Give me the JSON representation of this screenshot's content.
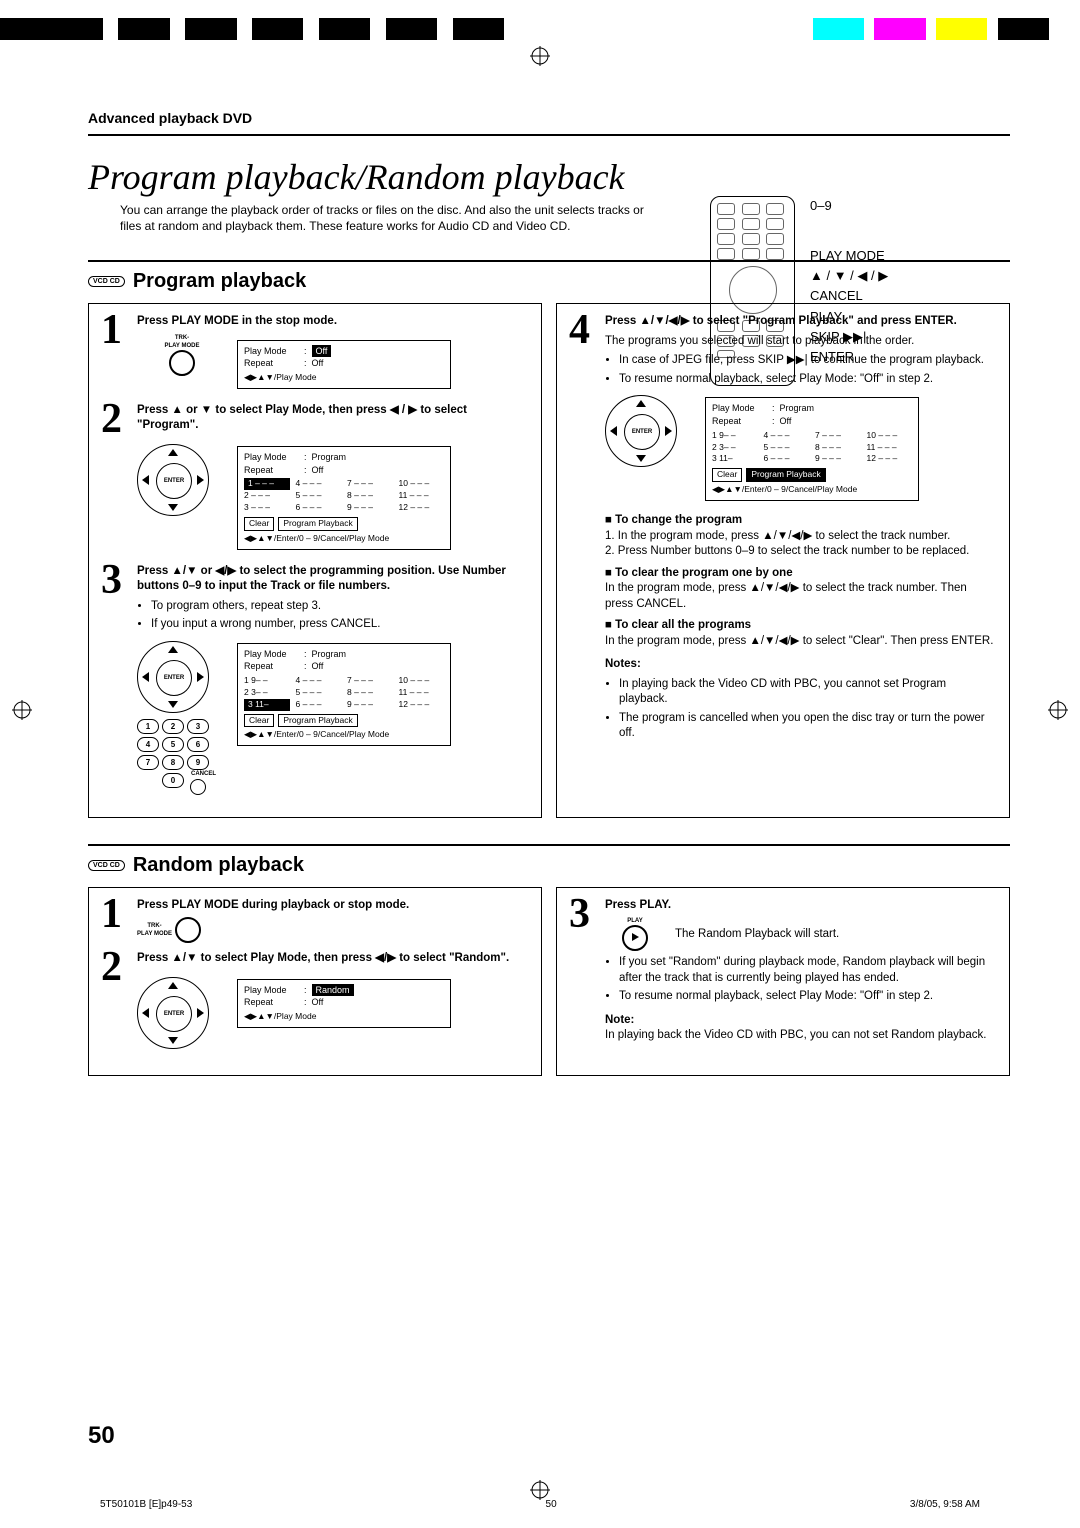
{
  "header": {
    "section": "Advanced playback DVD"
  },
  "title": "Program playback/Random playback",
  "intro": "You can arrange the playback order of tracks or files on the disc. And also the unit selects tracks or files at random and playback them. These feature works for Audio CD and Video CD.",
  "remote_labels": {
    "l0": "0–9",
    "l1": "PLAY MODE",
    "l2": "▲ / ▼ / ◀ / ▶",
    "l3": "CANCEL",
    "l4": "PLAY",
    "l5": "SKIP ▶▶|",
    "l6": "ENTER"
  },
  "program": {
    "badge": "VCD CD",
    "heading": "Program playback",
    "step1": {
      "title": "Press PLAY MODE in the stop mode.",
      "icon_label": "TRK-\nPLAY MODE",
      "osd": {
        "playmode": "Play Mode",
        "playmode_val": "Off",
        "repeat": "Repeat",
        "repeat_val": "Off",
        "foot": "◀▶▲▼/Play Mode"
      }
    },
    "step2": {
      "title": "Press ▲ or ▼ to select Play Mode, then press ◀ / ▶ to select \"Program\".",
      "enter": "ENTER",
      "osd": {
        "playmode": "Play Mode",
        "playmode_val": "Program",
        "repeat": "Repeat",
        "repeat_val": "Off",
        "grid": [
          "1 – – –",
          "4 – – –",
          "7 – – –",
          "10 – – –",
          "2 – – –",
          "5 – – –",
          "8 – – –",
          "11 – – –",
          "3 – – –",
          "6 – – –",
          "9 – – –",
          "12 – – –"
        ],
        "btn_clear": "Clear",
        "btn_prog": "Program Playback",
        "foot": "◀▶▲▼/Enter/0 – 9/Cancel/Play Mode"
      }
    },
    "step3": {
      "title": "Press ▲/▼ or ◀/▶ to select the programming position. Use Number buttons 0–9 to input the Track or file numbers.",
      "b1": "To program others, repeat step 3.",
      "b2": "If you input a wrong number, press CANCEL.",
      "cancel_word": "CANCEL",
      "enter": "ENTER",
      "numpad": [
        "1",
        "2",
        "3",
        "4",
        "5",
        "6",
        "7",
        "8",
        "9",
        "0"
      ],
      "cancel_label": "CANCEL",
      "osd": {
        "playmode": "Play Mode",
        "playmode_val": "Program",
        "repeat": "Repeat",
        "repeat_val": "Off",
        "grid": [
          "1 9– –",
          "4 – – –",
          "7 – – –",
          "10 – – –",
          "2 3– –",
          "5 – – –",
          "8 – – –",
          "11 – – –",
          "3 11–",
          "6 – – –",
          "9 – – –",
          "12 – – –"
        ],
        "btn_clear": "Clear",
        "btn_prog": "Program Playback",
        "foot": "◀▶▲▼/Enter/0 – 9/Cancel/Play Mode"
      }
    },
    "step4": {
      "title": "Press ▲/▼/◀/▶ to select \"Program Playback\" and press ENTER.",
      "body": "The programs you selected will start to playback in the order.",
      "b1": "In case of JPEG file, press SKIP ▶▶| to continue the program playback.",
      "b2": "To resume normal playback, select Play Mode: \"Off\" in step 2.",
      "enter": "ENTER",
      "osd": {
        "playmode": "Play Mode",
        "playmode_val": "Program",
        "repeat": "Repeat",
        "repeat_val": "Off",
        "grid": [
          "1 9– –",
          "4 – – –",
          "7 – – –",
          "10 – – –",
          "2 3– –",
          "5 – – –",
          "8 – – –",
          "11 – – –",
          "3 11–",
          "6 – – –",
          "9 – – –",
          "12 – – –"
        ],
        "btn_clear": "Clear",
        "btn_prog": "Program Playback",
        "foot": "◀▶▲▼/Enter/0 – 9/Cancel/Play Mode"
      },
      "change_h": "To change the program",
      "change_1": "In the program mode, press ▲/▼/◀/▶ to select the track number.",
      "change_2": "Press Number buttons 0–9 to select the track number to be replaced.",
      "clear1_h": "To clear the program one by one",
      "clear1": "In the program mode, press ▲/▼/◀/▶ to select the track number. Then press CANCEL.",
      "clearall_h": "To clear all the programs",
      "clearall": "In the program mode, press ▲/▼/◀/▶ to select \"Clear\". Then press ENTER.",
      "notes_h": "Notes:",
      "n1": "In playing back the Video CD with PBC, you cannot set Program playback.",
      "n2": "The program is cancelled when you open the disc tray or turn the power off."
    }
  },
  "random": {
    "badge": "VCD CD",
    "heading": "Random playback",
    "step1": {
      "title": "Press PLAY MODE during playback or stop mode.",
      "icon_label": "TRK-\nPLAY MODE"
    },
    "step2": {
      "title": "Press ▲/▼ to select Play Mode, then press ◀/▶ to select \"Random\".",
      "enter": "ENTER",
      "osd": {
        "playmode": "Play Mode",
        "playmode_val": "Random",
        "repeat": "Repeat",
        "repeat_val": "Off",
        "foot": "◀▶▲▼/Play Mode"
      }
    },
    "step3": {
      "title": "Press PLAY.",
      "play_label": "PLAY",
      "body": "The Random Playback will start.",
      "b1": "If you set \"Random\" during playback mode, Random playback will begin after the track that is currently being played has ended.",
      "b2": "To resume normal playback, select Play Mode: \"Off\" in step 2.",
      "note_h": "Note:",
      "note": "In playing back the Video CD with PBC, you can not set Random playback."
    }
  },
  "page_number": "50",
  "footer": {
    "left": "5T50101B [E]p49-53",
    "center": "50",
    "right": "3/8/05, 9:58 AM"
  },
  "colorbar_colors": [
    "#000",
    "#fff",
    "#000",
    "#fff",
    "#000",
    "#fff",
    "#000",
    "#fff",
    "#000",
    "#fff",
    "#000",
    "#fff",
    "#000",
    "#fff",
    "#000",
    "#fff",
    "#000",
    "#bbb",
    "#0ff",
    "#bbb",
    "#f0f",
    "#bbb",
    "#ff0",
    "#bbb",
    "#000"
  ]
}
